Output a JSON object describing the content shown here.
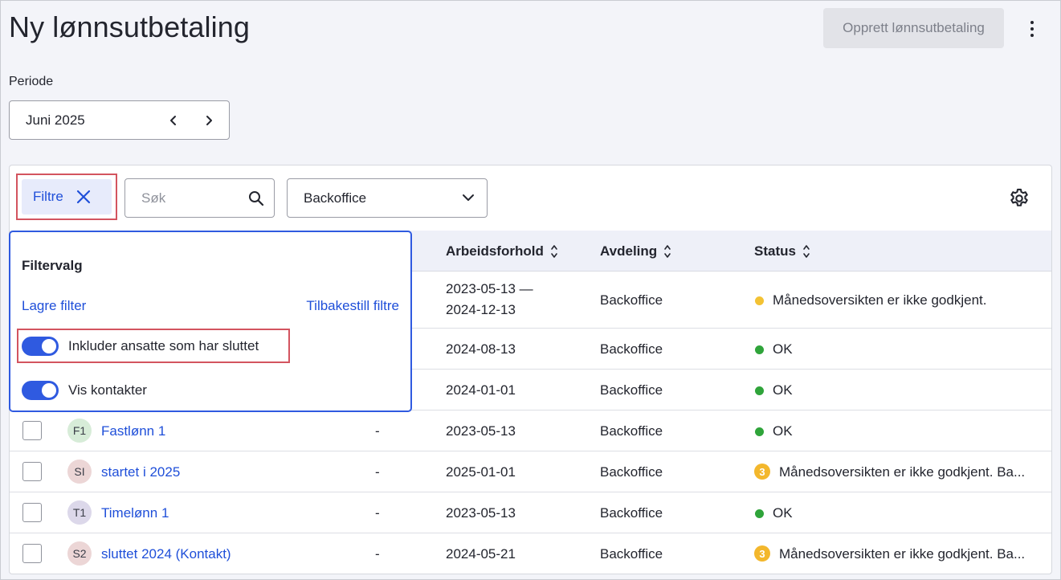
{
  "header": {
    "title": "Ny lønnsutbetaling",
    "create_button": "Opprett lønnsutbetaling"
  },
  "period": {
    "label": "Periode",
    "value": "Juni 2025"
  },
  "toolbar": {
    "filter_label": "Filtre",
    "search_placeholder": "Søk",
    "department_value": "Backoffice"
  },
  "table": {
    "columns": {
      "employment": "Arbeidsforhold",
      "department": "Avdeling",
      "status": "Status"
    },
    "rows": [
      {
        "employment_line1": "2023-05-13 —",
        "employment_line2": "2024-12-13",
        "department": "Backoffice",
        "status": "Månedsoversikten er ikke godkjent.",
        "status_kind": "warning-dot"
      },
      {
        "employment": "2024-08-13",
        "department": "Backoffice",
        "status": "OK",
        "status_kind": "ok"
      },
      {
        "employment": "2024-01-01",
        "department": "Backoffice",
        "status": "OK",
        "status_kind": "ok"
      },
      {
        "initials": "F1",
        "name": "Fastlønn 1",
        "dash": "-",
        "employment": "2023-05-13",
        "department": "Backoffice",
        "status": "OK",
        "status_kind": "ok"
      },
      {
        "initials": "SI",
        "name": "startet i 2025",
        "dash": "-",
        "employment": "2025-01-01",
        "department": "Backoffice",
        "status": "Månedsoversikten er ikke godkjent. Ba...",
        "status_kind": "count",
        "count": "3"
      },
      {
        "initials": "T1",
        "name": "Timelønn 1",
        "dash": "-",
        "employment": "2023-05-13",
        "department": "Backoffice",
        "status": "OK",
        "status_kind": "ok"
      },
      {
        "initials": "S2",
        "name": "sluttet 2024 (Kontakt)",
        "dash": "-",
        "employment": "2024-05-21",
        "department": "Backoffice",
        "status": "Månedsoversikten er ikke godkjent. Ba...",
        "status_kind": "count",
        "count": "3"
      }
    ]
  },
  "filter_panel": {
    "title": "Filtervalg",
    "save_filter": "Lagre filter",
    "reset_filters": "Tilbakestill filtre",
    "include_terminated": "Inkluder ansatte som har sluttet",
    "show_contacts": "Vis kontakter"
  },
  "colors": {
    "accent": "#2f5ae0",
    "link": "#1f4fd9",
    "ok": "#2fa43a",
    "warning": "#f3b72c",
    "highlight": "#d3545f"
  }
}
